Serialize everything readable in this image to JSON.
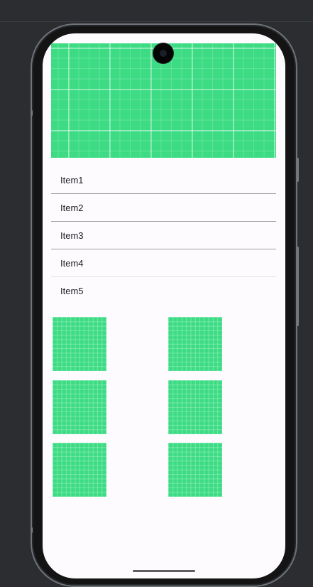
{
  "list": {
    "items": [
      {
        "label": "Item1"
      },
      {
        "label": "Item2"
      },
      {
        "label": "Item3"
      },
      {
        "label": "Item4"
      },
      {
        "label": "Item5"
      }
    ]
  },
  "grid": {
    "tile_count": 6
  },
  "colors": {
    "accent": "#3ddc84",
    "screen_background": "#fefbff",
    "frame": "#141414",
    "desktop_background": "#2b2d31"
  }
}
